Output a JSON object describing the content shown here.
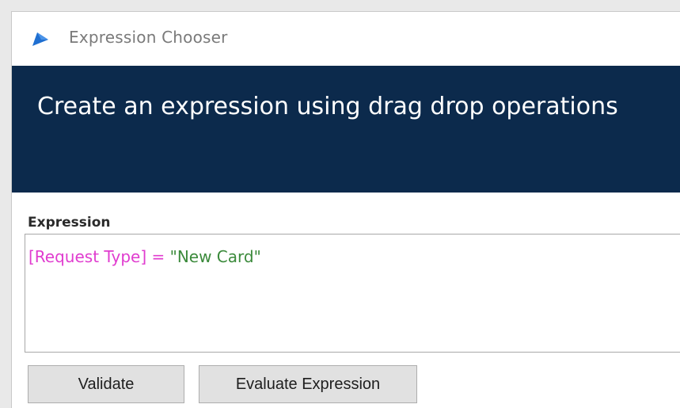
{
  "window": {
    "title": "Expression Chooser",
    "icon": "blue-dart-app-icon"
  },
  "banner": {
    "text": "Create an expression using drag drop operations",
    "background": "#0c2a4c"
  },
  "expression": {
    "label": "Expression",
    "field_token": "[Request Type]",
    "operator_token": "=",
    "string_token": "\"New Card\"",
    "field_color": "#e03ccf",
    "string_color": "#3b8a3b"
  },
  "buttons": {
    "validate_label": "Validate",
    "evaluate_label": "Evaluate Expression"
  }
}
